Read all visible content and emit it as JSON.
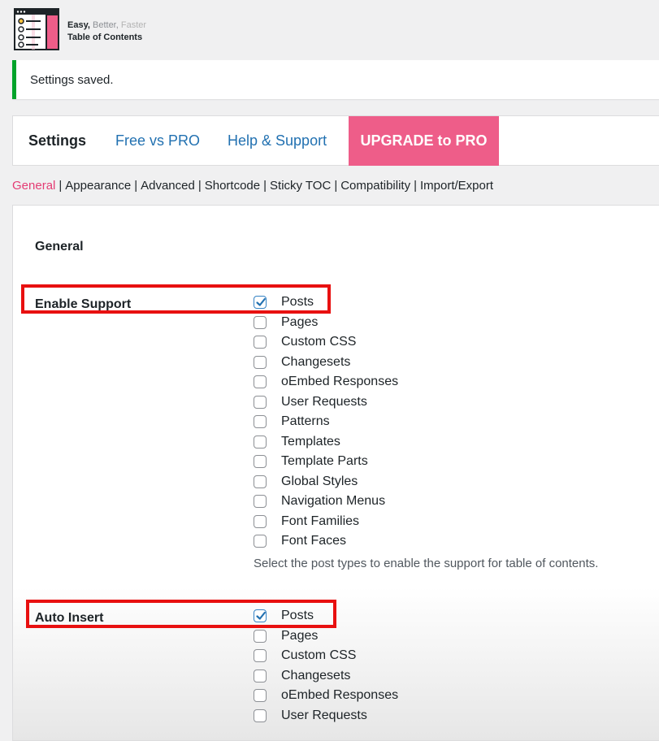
{
  "brand": {
    "easy": "Easy,",
    "better": "Better,",
    "faster": "Faster",
    "name": "Table of Contents"
  },
  "notice": {
    "text": "Settings saved."
  },
  "tabs": [
    {
      "label": "Settings"
    },
    {
      "label": "Free vs PRO"
    },
    {
      "label": "Help & Support"
    },
    {
      "label": "UPGRADE to PRO"
    }
  ],
  "subnav": [
    "General",
    "Appearance",
    "Advanced",
    "Shortcode",
    "Sticky TOC",
    "Compatibility",
    "Import/Export"
  ],
  "general": {
    "title": "General",
    "enable_support": {
      "label": "Enable Support",
      "options": [
        {
          "label": "Posts",
          "checked": true
        },
        {
          "label": "Pages",
          "checked": false
        },
        {
          "label": "Custom CSS",
          "checked": false
        },
        {
          "label": "Changesets",
          "checked": false
        },
        {
          "label": "oEmbed Responses",
          "checked": false
        },
        {
          "label": "User Requests",
          "checked": false
        },
        {
          "label": "Patterns",
          "checked": false
        },
        {
          "label": "Templates",
          "checked": false
        },
        {
          "label": "Template Parts",
          "checked": false
        },
        {
          "label": "Global Styles",
          "checked": false
        },
        {
          "label": "Navigation Menus",
          "checked": false
        },
        {
          "label": "Font Families",
          "checked": false
        },
        {
          "label": "Font Faces",
          "checked": false
        }
      ],
      "description": "Select the post types to enable the support for table of contents."
    },
    "auto_insert": {
      "label": "Auto Insert",
      "options": [
        {
          "label": "Posts",
          "checked": true
        },
        {
          "label": "Pages",
          "checked": false
        },
        {
          "label": "Custom CSS",
          "checked": false
        },
        {
          "label": "Changesets",
          "checked": false
        },
        {
          "label": "oEmbed Responses",
          "checked": false
        },
        {
          "label": "User Requests",
          "checked": false
        }
      ]
    }
  },
  "colors": {
    "accent": "#ee5d89",
    "link": "#2271b1",
    "active_sub": "#e43c74",
    "notice": "#00a32a",
    "highlight": "#e81010"
  }
}
